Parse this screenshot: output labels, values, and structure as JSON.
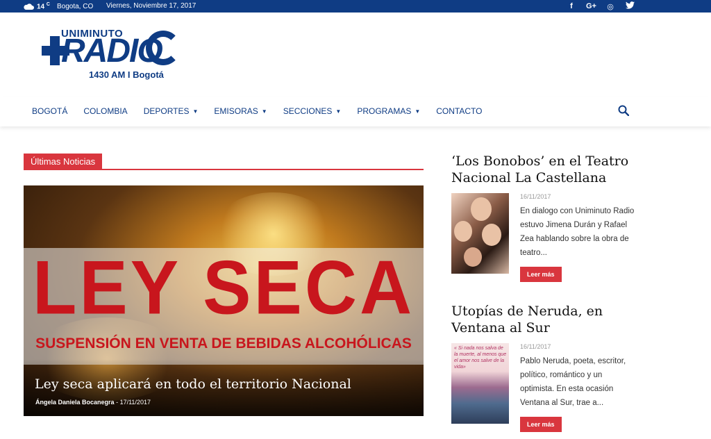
{
  "topbar": {
    "temperature": "14",
    "temp_unit": "C",
    "location": "Bogota, CO",
    "date": "Viernes, Noviembre 17, 2017",
    "social": [
      {
        "icon": "facebook-icon",
        "glyph": "f"
      },
      {
        "icon": "google-plus-icon",
        "glyph": "G+"
      },
      {
        "icon": "instagram-icon",
        "glyph": "◎"
      },
      {
        "icon": "twitter-icon",
        "glyph": "🐦"
      }
    ]
  },
  "logo": {
    "top_text": "UNIMINUTO",
    "main_text": "RADIO",
    "frequency": "1430 AM I Bogotá"
  },
  "nav": {
    "items": [
      {
        "label": "BOGOTÁ",
        "has_dropdown": false
      },
      {
        "label": "COLOMBIA",
        "has_dropdown": false
      },
      {
        "label": "DEPORTES",
        "has_dropdown": true
      },
      {
        "label": "EMISORAS",
        "has_dropdown": true
      },
      {
        "label": "SECCIONES",
        "has_dropdown": true
      },
      {
        "label": "PROGRAMAS",
        "has_dropdown": true
      },
      {
        "label": "CONTACTO",
        "has_dropdown": false
      }
    ],
    "chevron": "⌄",
    "search_icon": "search-icon"
  },
  "section": {
    "label": "Últimas Noticias"
  },
  "featured": {
    "image_big_text": "LEY SECA",
    "image_sub_text": "SUSPENSIÓN EN VENTA DE BEBIDAS ALCOHÓLICAS",
    "title": "Ley seca aplicará en todo el territorio Nacional",
    "author": "Ángela Daniela Bocanegra",
    "separator": "-",
    "date": "17/11/2017"
  },
  "articles": [
    {
      "title": "‘Los Bonobos’ en el Teatro Nacional La Castellana",
      "date": "16/11/2017",
      "excerpt": "En dialogo con Uniminuto Radio estuvo Jimena Durán y Rafael Zea hablando sobre la obra de teatro...",
      "button": "Leer más"
    },
    {
      "title": "Utopías de Neruda, en Ventana al Sur",
      "date": "16/11/2017",
      "excerpt": "Pablo Neruda, poeta, escritor, político,  romántico y un optimista. En esta ocasión Ventana al Sur, trae a...",
      "button": "Leer más",
      "thumb_quote": "« Si nada nos salva de la muerte, al menos que el amor nos salve de la vida»"
    }
  ],
  "colors": {
    "brand_blue": "#0f3c84",
    "accent_red": "#d9363e"
  }
}
